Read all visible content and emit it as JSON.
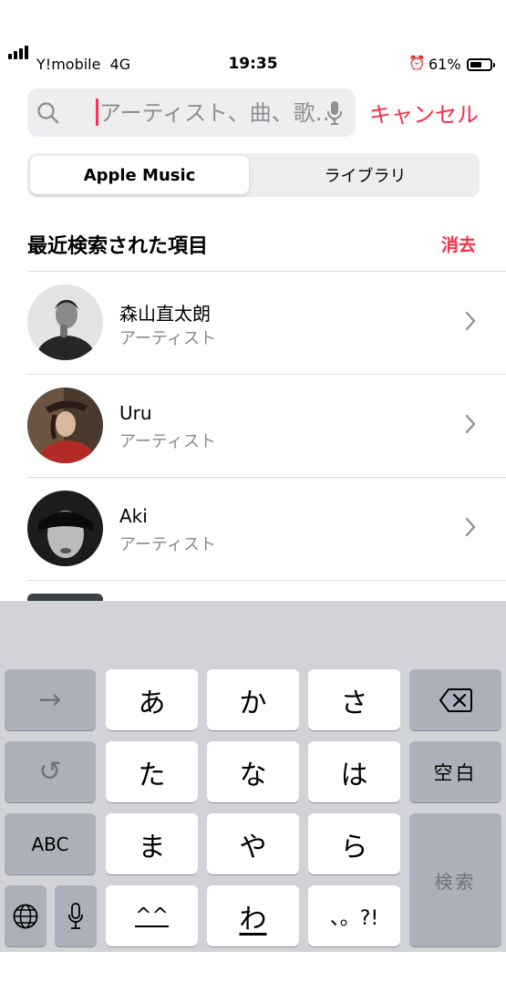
{
  "status_bar": {
    "carrier": "Y!mobile",
    "network": "4G",
    "time": "19:35",
    "battery": "61%",
    "battery_level": 0.61
  },
  "search": {
    "placeholder": "アーティスト、曲、歌…",
    "cancel_label": "キャンセル"
  },
  "segments": [
    {
      "label": "Apple Music",
      "selected": true
    },
    {
      "label": "ライブラリ",
      "selected": false
    }
  ],
  "recent": {
    "title": "最近検索された項目",
    "clear_label": "消去",
    "items": [
      {
        "name": "森山直太朗",
        "subtitle": "アーティスト"
      },
      {
        "name": "Uru",
        "subtitle": "アーティスト"
      },
      {
        "name": "Aki",
        "subtitle": "アーティスト"
      }
    ]
  },
  "keyboard": {
    "next_key": "→",
    "undo_key": "↺",
    "abc_key": "ABC",
    "space_key": "空白",
    "search_key": "検索",
    "kana": [
      "あ",
      "か",
      "さ",
      "た",
      "な",
      "は",
      "ま",
      "や",
      "ら",
      "^^",
      "わ",
      "、。?!"
    ]
  }
}
